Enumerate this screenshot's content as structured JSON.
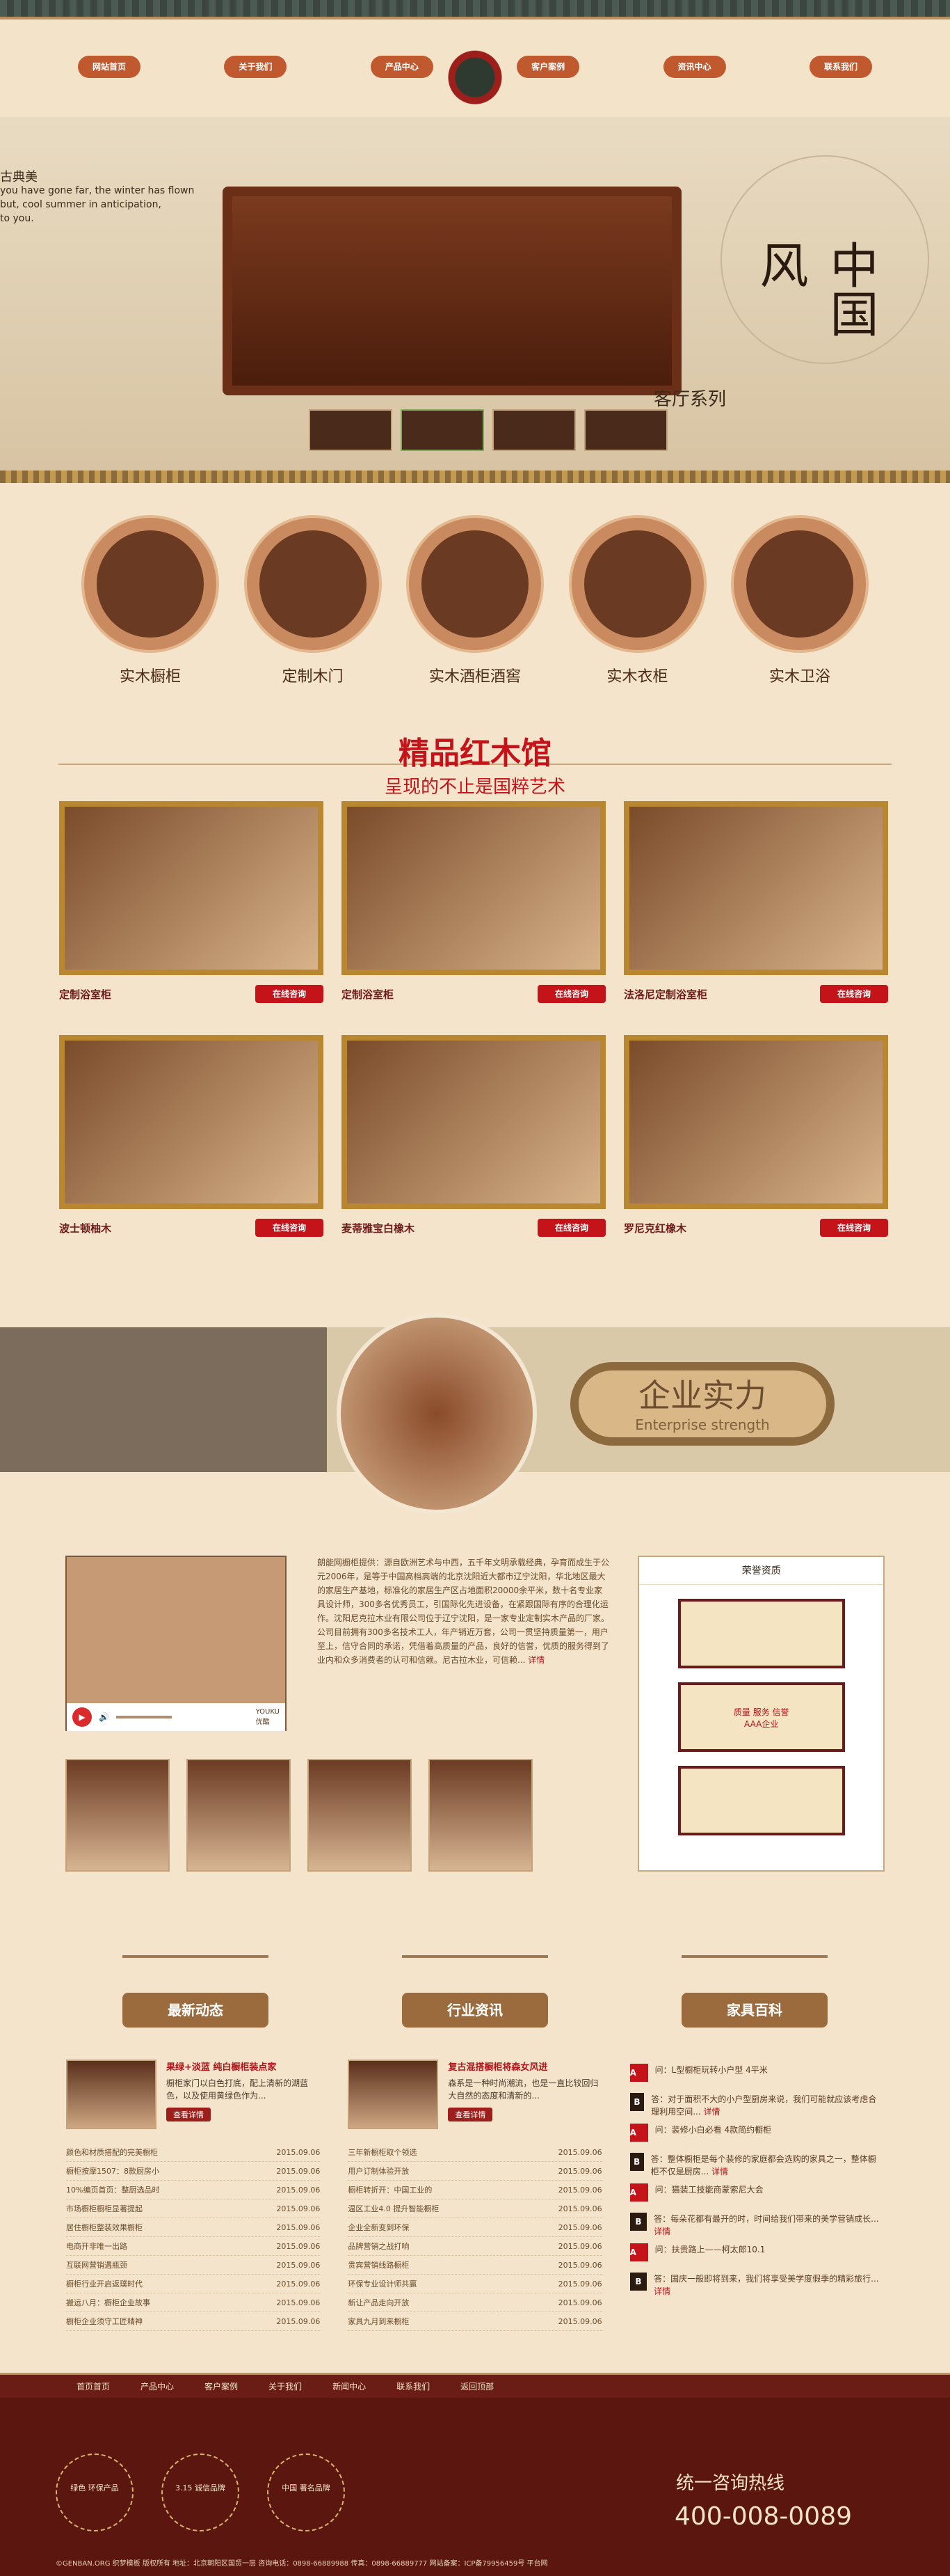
{
  "nav": {
    "items": [
      "网站首页",
      "关于我们",
      "产品中心",
      "客户案例",
      "资讯中心",
      "联系我们"
    ]
  },
  "banner": {
    "title": "古典美",
    "en": [
      "you have gone far, the winter has flown",
      "but, cool summer in anticipation,",
      "to you."
    ],
    "series": "客厅系列",
    "seal_text": "中国风"
  },
  "categories": [
    "实木橱柜",
    "定制木门",
    "实木酒柜酒窖",
    "实木衣柜",
    "实木卫浴"
  ],
  "products": {
    "title": "精品红木馆",
    "subtitle": "呈现的不止是国粹艺术",
    "items": [
      {
        "name": "定制浴室柜",
        "button": "在线咨询"
      },
      {
        "name": "定制浴室柜",
        "button": "在线咨询"
      },
      {
        "name": "法洛尼定制浴室柜",
        "button": "在线咨询"
      },
      {
        "name": "波士顿柚木",
        "button": "在线咨询"
      },
      {
        "name": "麦蒂雅宝白橡木",
        "button": "在线咨询"
      },
      {
        "name": "罗尼克红橡木",
        "button": "在线咨询"
      }
    ]
  },
  "strength": {
    "title_cn": "企业实力",
    "title_en": "Enterprise strength"
  },
  "company": {
    "intro": "朗能网橱柜提供：源自欧洲艺术与中西，五千年文明承载经典，孕育而成生于公元2006年，是等于中国高档高端的北京沈阳近大都市辽宁沈阳，华北地区最大的家居生产基地，标准化的家居生产区占地面积20000余平米，数十名专业家具设计师，300多名优秀员工，引国际化先进设备，在紧跟国际有序的合理化运作。沈阳尼克拉木业有限公司位于辽宁沈阳，是一家专业定制实木产品的厂家。公司目前拥有300多名技术工人，年产销近万套，公司一贯坚持质量第一，用户至上，信守合同的承诺，凭借着高质量的产品，良好的信誉，优质的服务得到了业内和众多消费者的认可和信赖。尼古拉木业，可信赖...",
    "more": "详情",
    "video_brand": "优酷",
    "video_brand_en": "YOUKU",
    "honors_title": "荣誉资质",
    "honor_text": "质量 服务 信誉",
    "honor_sub": "AAA企业"
  },
  "boards": [
    "最新动态",
    "行业资讯",
    "家具百科"
  ],
  "news": {
    "col1": {
      "feature_title": "果绿+淡蓝 纯白橱柜装点家",
      "feature_text": "橱柜家门以白色打底，配上清新的湖蓝色，以及使用黄绿色作为...",
      "button": "查看详情",
      "items": [
        {
          "title": "颜色和材质搭配的完美橱柜",
          "date": "2015.09.06"
        },
        {
          "title": "橱柜按摩1507：8款厨房小",
          "date": "2015.09.06"
        },
        {
          "title": "10%编页首页：整厨选品时",
          "date": "2015.09.06"
        },
        {
          "title": "市场橱柜橱柜显著提起",
          "date": "2015.09.06"
        },
        {
          "title": "居住橱柜整装效果橱柜",
          "date": "2015.09.06"
        },
        {
          "title": "电商开非唯一出路",
          "date": "2015.09.06"
        },
        {
          "title": "互联网营销遇瓶颈",
          "date": "2015.09.06"
        },
        {
          "title": "橱柜行业开启返璞时代",
          "date": "2015.09.06"
        },
        {
          "title": "搬运八月：橱柜企业故事",
          "date": "2015.09.06"
        },
        {
          "title": "橱柜企业须守工匠精神",
          "date": "2015.09.06"
        }
      ]
    },
    "col2": {
      "feature_title": "复古混搭橱柜将森女风进",
      "feature_text": "森系是一种时尚潮流，也是一直比较回归大自然的态度和清新的...",
      "button": "查看详情",
      "items": [
        {
          "title": "三年新橱柜取个领选",
          "date": "2015.09.06"
        },
        {
          "title": "用户订制体验开放",
          "date": "2015.09.06"
        },
        {
          "title": "橱柜转折开：中国工业的",
          "date": "2015.09.06"
        },
        {
          "title": "温区工业4.0 提升智能橱柜",
          "date": "2015.09.06"
        },
        {
          "title": "企业全新变到环保",
          "date": "2015.09.06"
        },
        {
          "title": "品牌营销之战打响",
          "date": "2015.09.06"
        },
        {
          "title": "贵宾营销线路橱柜",
          "date": "2015.09.06"
        },
        {
          "title": "环保专业设计师共赢",
          "date": "2015.09.06"
        },
        {
          "title": "新让产品走向开放",
          "date": "2015.09.06"
        },
        {
          "title": "家具九月到来橱柜",
          "date": "2015.09.06"
        }
      ]
    },
    "col3": [
      {
        "q": "问：L型橱柜玩转小户型 4平米",
        "a": "答：对于面积不大的小户型厨房来说，我们可能就应该考虑合理利用空间...",
        "more": "详情"
      },
      {
        "q": "问：装修小白必看 4款简约橱柜",
        "a": "答：整体橱柜是每个装修的家庭都会选购的家具之一，整体橱柜不仅是厨房...",
        "more": "详情"
      },
      {
        "q": "问：猫装工技能商蒙索尼大会",
        "a": "答：每朵花都有最开的时，时间给我们带来的美学营销成长...",
        "more": "详情"
      },
      {
        "q": "问：扶贵路上——柯太郎10.1",
        "a": "答：国庆一般即将到来，我们将享受美学度假季的精彩旅行...",
        "more": "详情"
      }
    ]
  },
  "footer_nav": [
    "首页首页",
    "产品中心",
    "客户案例",
    "关于我们",
    "新闻中心",
    "联系我们",
    "返回顶部"
  ],
  "footer": {
    "badges": [
      "绿色\n环保产品",
      "3.15\n诚信品牌",
      "中国\n著名品牌"
    ],
    "hotline_title": "统一咨询热线",
    "phone": "400-008-0089",
    "copyright": "©GENBAN.ORG 织梦模板 版权所有   地址：北京朝阳区国贸一层   咨询电话：0898-66889988   传真：0898-66889777   网站备案：ICP备79956459号 平台网"
  }
}
